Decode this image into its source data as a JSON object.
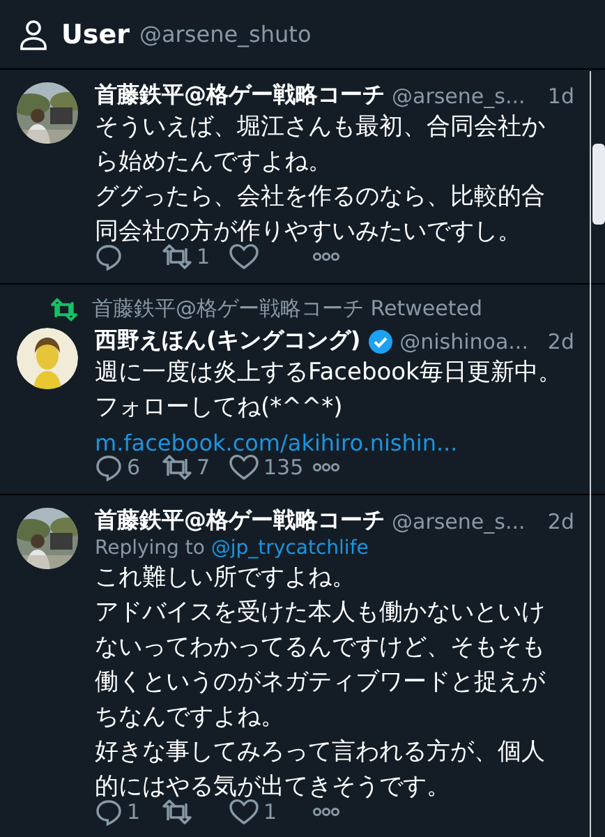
{
  "header": {
    "title": "User",
    "handle": "@arsene_shuto"
  },
  "tweets": [
    {
      "name": "首藤鉄平@格ゲー戦略コーチ",
      "verified": false,
      "handle": "@arsene_s...",
      "time": "1d",
      "paragraphs": [
        "そういえば、堀江さんも最初、合同会社から始めたんですよね。",
        "ググったら、会社を作るのなら、比較的合同会社の方が作りやすいみたいですし。"
      ],
      "actions": [
        {
          "kind": "reply"
        },
        {
          "kind": "retweet",
          "count": "1"
        },
        {
          "kind": "like"
        },
        {
          "kind": "more"
        }
      ]
    },
    {
      "retweet_context": "首藤鉄平@格ゲー戦略コーチ Retweeted",
      "name": "西野えほん(キングコング)",
      "verified": true,
      "handle": "@nishinoa...",
      "time": "2d",
      "paragraphs": [
        "週に一度は炎上するFacebook毎日更新中。",
        "フォローしてね(*^^*)"
      ],
      "link": "m.facebook.com/akihiro.nishin...",
      "actions": [
        {
          "kind": "reply",
          "count": "6"
        },
        {
          "kind": "retweet",
          "count": "7"
        },
        {
          "kind": "like",
          "count": "135"
        },
        {
          "kind": "more"
        }
      ]
    },
    {
      "name": "首藤鉄平@格ゲー戦略コーチ",
      "verified": false,
      "handle": "@arsene_s...",
      "time": "2d",
      "replying_to": {
        "label": "Replying to",
        "handle": "@jp_trycatchlife"
      },
      "paragraphs": [
        "これ難しい所ですよね。",
        "アドバイスを受けた本人も働かないといけないってわかってるんですけど、そもそも働くというのがネガティブワードと捉えがちなんですよね。",
        "好きな事してみろって言われる方が、個人的にはやる気が出てきそうです。"
      ],
      "actions": [
        {
          "kind": "reply",
          "count": "1"
        },
        {
          "kind": "retweet"
        },
        {
          "kind": "like",
          "count": "1"
        },
        {
          "kind": "more"
        }
      ]
    }
  ]
}
